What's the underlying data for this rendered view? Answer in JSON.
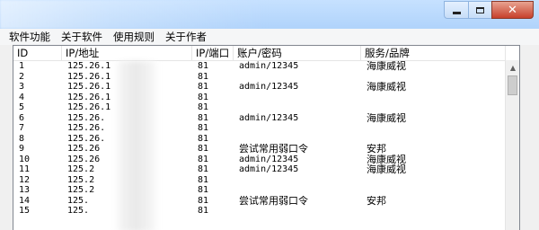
{
  "menu": [
    "软件功能",
    "关于软件",
    "使用规则",
    "关于作者"
  ],
  "columns": [
    "ID",
    "IP/地址",
    "IP/端口",
    "账户/密码",
    "服务/品牌"
  ],
  "rows": [
    {
      "id": "1",
      "ip": "125.26.1",
      "port": "81",
      "account": "admin/12345",
      "brand": "海康威视"
    },
    {
      "id": "2",
      "ip": "125.26.1",
      "port": "81",
      "account": "",
      "brand": ""
    },
    {
      "id": "3",
      "ip": "125.26.1",
      "port": "81",
      "account": "admin/12345",
      "brand": "海康威视"
    },
    {
      "id": "4",
      "ip": "125.26.1",
      "port": "81",
      "account": "",
      "brand": ""
    },
    {
      "id": "5",
      "ip": "125.26.1",
      "port": "81",
      "account": "",
      "brand": ""
    },
    {
      "id": "6",
      "ip": "125.26.",
      "port": "81",
      "account": "admin/12345",
      "brand": "海康威视"
    },
    {
      "id": "7",
      "ip": "125.26.",
      "port": "81",
      "account": "",
      "brand": ""
    },
    {
      "id": "8",
      "ip": "125.26.",
      "port": "81",
      "account": "",
      "brand": ""
    },
    {
      "id": "9",
      "ip": "125.26",
      "port": "81",
      "account": "尝试常用弱口令",
      "brand": "安邦"
    },
    {
      "id": "10",
      "ip": "125.26",
      "port": "81",
      "account": "admin/12345",
      "brand": "海康威视"
    },
    {
      "id": "11",
      "ip": "125.2",
      "port": "81",
      "account": "admin/12345",
      "brand": "海康威视"
    },
    {
      "id": "12",
      "ip": "125.2",
      "port": "81",
      "account": "",
      "brand": ""
    },
    {
      "id": "13",
      "ip": "125.2",
      "port": "81",
      "account": "",
      "brand": ""
    },
    {
      "id": "14",
      "ip": "125.",
      "port": "81",
      "account": "尝试常用弱口令",
      "brand": "安邦"
    },
    {
      "id": "15",
      "ip": "125.",
      "port": "81",
      "account": "",
      "brand": ""
    }
  ],
  "window_controls": {
    "minimize": "",
    "maximize": "",
    "close": "✕"
  },
  "colors": {
    "titlebar": "#b8d8ff",
    "close": "#c7402b",
    "list_bg": "#ffffff"
  }
}
